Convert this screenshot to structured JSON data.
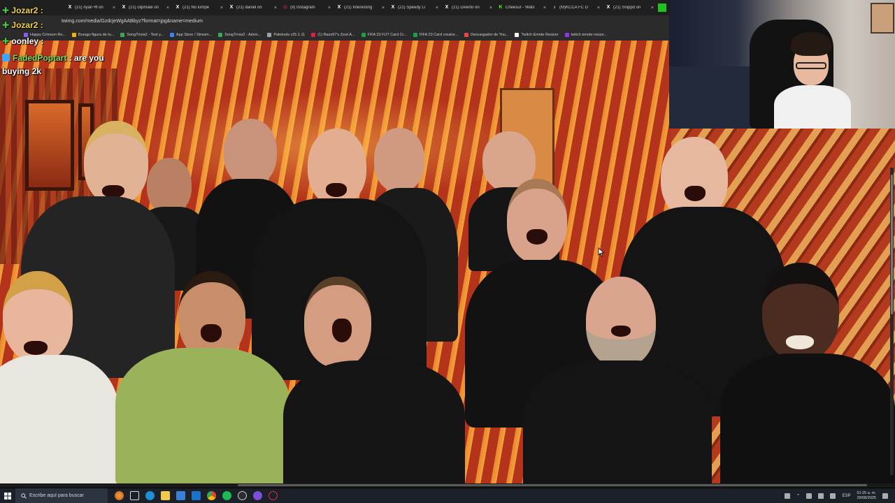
{
  "browser": {
    "tabs": [
      {
        "label": "(21) nyan •ff on",
        "icon": "x-icon"
      },
      {
        "label": "(21) clipmate on",
        "icon": "x-icon"
      },
      {
        "label": "(21) No lumpe",
        "icon": "x-icon"
      },
      {
        "label": "(21) daniel on",
        "icon": "x-icon"
      },
      {
        "label": "(9) Instagram",
        "icon": "instagram-icon"
      },
      {
        "label": "(21) Interesting",
        "icon": "x-icon"
      },
      {
        "label": "(21) Speedy Li",
        "icon": "x-icon"
      },
      {
        "label": "(21) Diverto on",
        "icon": "x-icon"
      },
      {
        "label": "Cheesur - Wats",
        "icon": "kick-icon"
      },
      {
        "label": "(M)KCCA FC D",
        "icon": "tiktok-icon"
      },
      {
        "label": "(21) Snippd on",
        "icon": "x-icon"
      }
    ],
    "url": "twimg.com/media/GzdcjeWgAABbyz?format=jpg&name=medium",
    "bookmarks": [
      "Happy Crimson Ro...",
      "Burago figura de to...",
      "SongTrivia2 - Test y...",
      "App Store / Stream...",
      "SongTrivia2 - Advin...",
      "Paletools v25.1.11",
      "(1) Razo97's Zest-A...",
      "FIFA 23 FUT Card Cr...",
      "FIFA 23 Card creator...",
      "Descargador de You...",
      "Twitch Emote Resizer",
      "twitch emote resize..."
    ]
  },
  "chat": {
    "line1_user": "Jozar2 :",
    "line2_user": "Jozar2 :",
    "line3_user": "FadedPoptart",
    "line3_msg_a": ": are you",
    "line3_msg_b": "buying 2k",
    "line4_user": "oonley :"
  },
  "taskbar": {
    "search_placeholder": "Escribe aquí para buscar",
    "language": "ESP",
    "time": "01:25 a. m.",
    "date": "29/08/2025"
  },
  "colors": {
    "chat_user_a": "#f4d34b",
    "chat_user_b": "#7fdc5b",
    "taskbar": "#1b2029"
  }
}
